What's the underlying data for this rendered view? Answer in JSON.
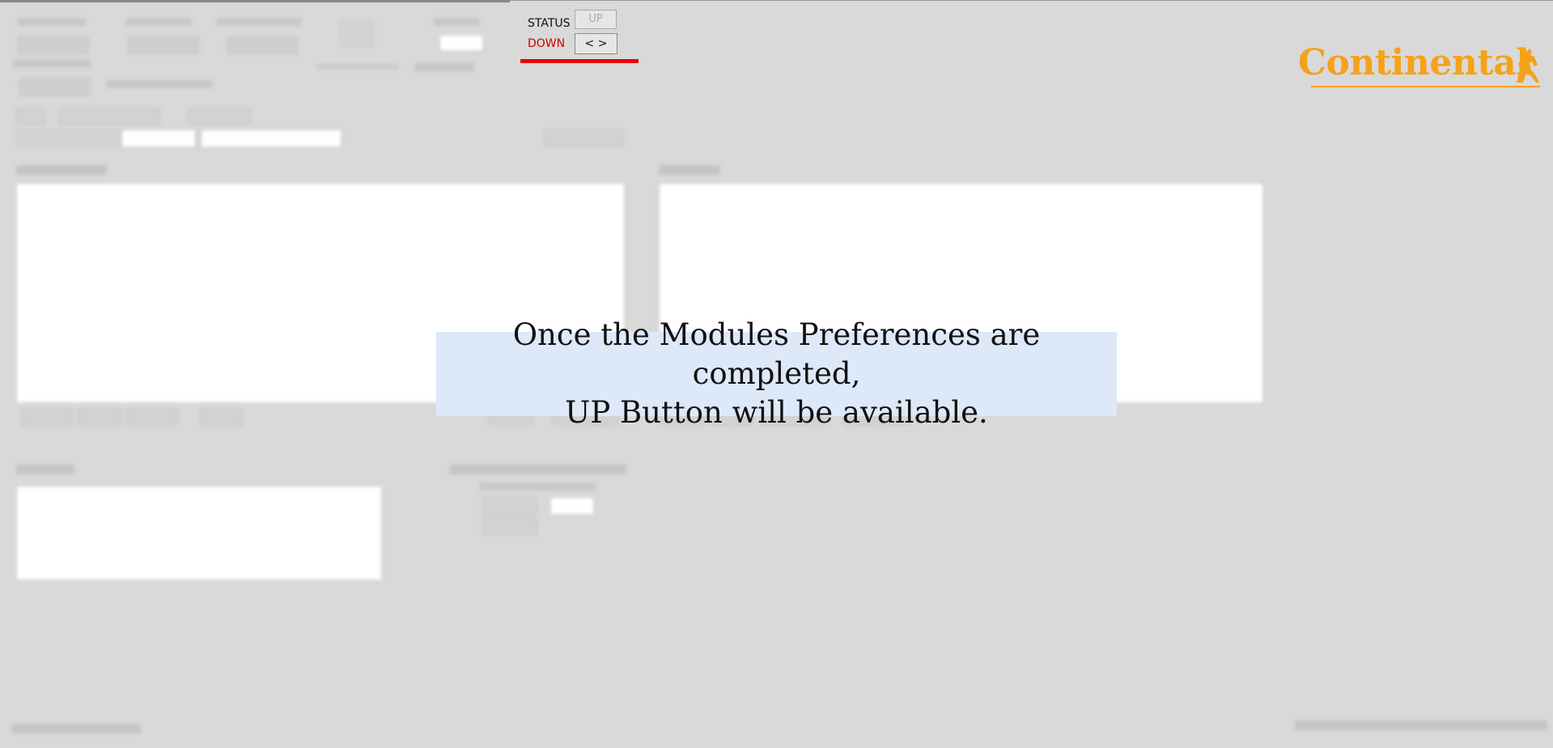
{
  "status_panel": {
    "status_label": "STATUS",
    "up_button_label": "UP",
    "down_label": "DOWN",
    "nav_button_label": "< >",
    "up_enabled": false,
    "accent_color": "#e8000b"
  },
  "logo": {
    "text": "Continental",
    "color": "#f5a21a",
    "icon": "horse-icon"
  },
  "overlay": {
    "line1": "Once the Modules Preferences are completed,",
    "line2": "UP Button will be available."
  }
}
